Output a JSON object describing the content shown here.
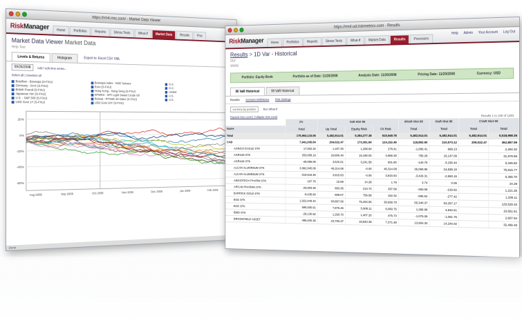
{
  "back_window": {
    "title": "https://rm4.rmc.com/ - Market Data Viewer",
    "logo": "RiskManager",
    "nav": [
      "Home",
      "Portfolios",
      "Reports",
      "Stress Tests",
      "What-If",
      "Market Data",
      "Results",
      "Proc"
    ],
    "page_title": "Market Data Viewer",
    "page_title_suffix": "Market Data",
    "sub": "Help Text",
    "tabs": [
      "Levels & Returns",
      "Histogram"
    ],
    "export": "Export to: Excel CSV XML",
    "date": "09/26/2008",
    "add_series": "Add / edit time series...",
    "links": "Select all | Unselect all",
    "legend": [
      "Brazilian - Bovespa (S-FXU)",
      "Bovespa Index - NSE Sensex",
      "G.S.",
      "Germany - DAX (S-FXU)",
      "Euro (S-FXU)",
      "G.S.",
      "British Pound (S-FXU)",
      "Hong Kong - Hang Seng (S-FXU)",
      "United",
      "Japanese Yen (S-FXU)",
      "NTWKS - WTI Light Sweet Crude Oil",
      "U.S.",
      "U.S. - S&P 500 (S-FXU)",
      "Russia - RTSSE 30 Index (S-FXU)",
      "U.S.",
      "USD Govt 1Y (S-FXU)",
      "USD Govt 10Y (S-FXU)",
      ""
    ],
    "x_ticks": [
      "Aug 2008",
      "Sep 2008",
      "Oct 2008",
      "Nov 2008",
      "Dec 2008",
      "Jan 2009",
      "Feb 2009"
    ],
    "y_ticks": [
      "20%",
      "0%",
      "-20%",
      "-40%",
      "-60%"
    ],
    "status": "Done"
  },
  "front_window": {
    "title": "https://rm4.ud.riskmetrics.com - Results",
    "logo": "RiskManager",
    "nav": [
      "Home",
      "Portfolios",
      "Reports",
      "Stress Tests",
      "What-If",
      "Market Data",
      "Results",
      "Processes"
    ],
    "toplinks": [
      "Help",
      "Admin",
      "Your Account",
      "Log Out"
    ],
    "breadcrumb": "Results",
    "page_title": "1D Var - Historical",
    "sub_lines": [
      "DEF",
      "WWW"
    ],
    "info": {
      "portfolio": "Portfolio: Equity Book",
      "portfolio_date": "Portfolio as of Date: 11/20/2008",
      "analysis_date": "Analysis Date: 11/20/2008",
      "pricing_date": "Pricing Date: 11/20/2008",
      "currency": "Currency: USD"
    },
    "tabs": [
      "95 VaR Historical",
      "99 VaR Historical"
    ],
    "subtabs": [
      "Results",
      "Scenario Definitions",
      "Risk Settings"
    ],
    "grouping": "currency by position",
    "run_whatif": "Run What-If",
    "expand_links": "Expand One Level | Collapse One Level",
    "paging": "Results 1 to 100 of 1283",
    "group_headers": [
      "PV",
      "VaR Hist 95",
      "MVaR Hist 95",
      "IVaR Hist 95",
      "CVaR Hist 95"
    ],
    "col_headers": [
      "Name",
      "Total",
      "Up Total",
      "Equity Risk",
      "FX Risk",
      "Total",
      "Total",
      "Total",
      "Total"
    ],
    "rows": [
      [
        "Total",
        "175,963,133.06",
        "5,482,914.01",
        "5,384,377.38",
        "515,949.78",
        "5,482,914.01",
        "5,482,914.01",
        "5,482,914.01",
        "5,518,968.35"
      ],
      [
        "CAD",
        "7,941,035.54",
        "204,022.47",
        "173,361.84",
        "124,152.46",
        "118,892.90",
        "210,573.12",
        "209,022.47",
        "362,857.09"
      ],
      [
        "AGNICO EAGLE STK",
        "17,002.34",
        "1,407.30",
        "1,268.94",
        "278.41",
        "-1,066.41",
        "669.13",
        "",
        "2,284.32"
      ],
      [
        "AGRIUM STK",
        "253,058.19",
        "20,800.40",
        "19,180.02",
        "4,866.30",
        "755.29",
        "16,147.09",
        "",
        "31,979.96"
      ],
      [
        "AGRIUM STK",
        "-49,096.06",
        "3,620.01",
        "3,241.59",
        "601.80",
        "-140.76",
        "-3,156.44",
        "",
        "5,346.82"
      ],
      [
        "ALCAN ALUMINIUM STK",
        "3,062,045.06",
        "46,314.08",
        "-0.00",
        "46,314.08",
        "35,068.86",
        "24,838.15",
        "",
        "75,915.77"
      ],
      [
        "ALCAN ALUMINIUM STK",
        "-319,616.45",
        "3,815.63",
        "-0.00",
        "3,815.63",
        "-3,426.31",
        "-2,550.15",
        "",
        "6,365.70"
      ],
      [
        "ANGIOTECH PHARM STK",
        "107.76",
        "15.69",
        "14.28",
        "1.79",
        "3.74",
        "0.06",
        "",
        "24.28"
      ],
      [
        "ARCAN PHARMA STK",
        "-26,903.36",
        "993.36",
        "213.74",
        "337.08",
        "-293.08",
        "-219.62",
        "",
        "1,221.26"
      ],
      [
        "BARRICK GOLD STK",
        "-9,435.60",
        "809.07",
        "756.58",
        "152.34",
        "-696.52",
        "-277.42",
        "",
        "1,339.11"
      ],
      [
        "BCE STK",
        "1,022,449.42",
        "93,867.06",
        "75,263.56",
        "30,830.70",
        "55,340.37",
        "53,257.17",
        "",
        "125,529.33"
      ],
      [
        "BCE STK",
        "595,005.61",
        "7,875.46",
        "5,908.11",
        "6,060.75",
        "1,286.98",
        "4,844.51",
        "",
        "10,551.61"
      ],
      [
        "BMO STK",
        "-28,130.92",
        "1,293.70",
        "1,407.20",
        "476.73",
        "-1,075.08",
        "-1,061.76",
        "",
        "2,607.94"
      ],
      [
        "BROOKFIELD ASSET",
        "495,200.36",
        "23,700.37",
        "18,843.39",
        "7,371.48",
        "13,654.32",
        "14,244.02",
        "",
        "32,466.45"
      ]
    ],
    "status": "Done"
  },
  "colors": {
    "brand": "#9b1c2c",
    "info_green": "#cfe6c5",
    "link": "#336699"
  }
}
